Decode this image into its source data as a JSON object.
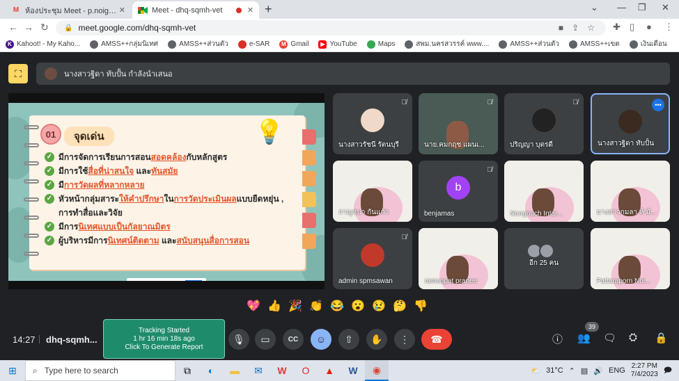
{
  "browser": {
    "tabs": [
      {
        "title": "ห้องประชุม Meet - p.noigor@gmail",
        "icon": "gmail-icon"
      },
      {
        "title": "Meet - dhq-sqmh-vet",
        "icon": "meet-icon"
      }
    ],
    "url": "meet.google.com/dhq-sqmh-vet",
    "bookmarks": [
      {
        "label": "Kahoot! - My Kaho...",
        "color": "#46178f"
      },
      {
        "label": "AMSS++กลุ่มนิเทศ",
        "color": "#3c4043"
      },
      {
        "label": "AMSS++ส่วนตัว",
        "color": "#3c4043"
      },
      {
        "label": "e-SAR",
        "color": "#d93025"
      },
      {
        "label": "Gmail",
        "color": "#ea4335"
      },
      {
        "label": "YouTube",
        "color": "#ff0000"
      },
      {
        "label": "Maps",
        "color": "#34a853"
      },
      {
        "label": "สพม.นครสวรรค์ www....",
        "color": "#3c4043"
      },
      {
        "label": "AMSS++ส่วนตัว",
        "color": "#3c4043"
      },
      {
        "label": "AMSS++เขต",
        "color": "#3c4043"
      },
      {
        "label": "เงินเดือน",
        "color": "#3c4043"
      }
    ]
  },
  "meet": {
    "presenter_text": "นางสาวฐิดา ทับปั้น กำลังนำเสนอ",
    "slide": {
      "number": "01",
      "title": "จุดเด่น",
      "bullets": [
        [
          {
            "t": "มีการจัดการเรียนการสอน",
            "h": false
          },
          {
            "t": "สอดคล้อง",
            "h": true
          },
          {
            "t": "กับหลักสูตร",
            "h": false
          }
        ],
        [
          {
            "t": "มีการใช้",
            "h": false
          },
          {
            "t": "สื่อที่น่าสนใจ",
            "h": true
          },
          {
            "t": " และ",
            "h": false
          },
          {
            "t": "ทันสมัย",
            "h": true
          }
        ],
        [
          {
            "t": "มี",
            "h": false
          },
          {
            "t": "การวัดผลที่หลากหลาย",
            "h": true
          }
        ],
        [
          {
            "t": "หัวหน้ากลุ่มสาระ",
            "h": false
          },
          {
            "t": "ให้คำปรึกษา",
            "h": true
          },
          {
            "t": "ใน",
            "h": false
          },
          {
            "t": "การวัดประเมินผล",
            "h": true
          },
          {
            "t": "แบบยืดหยุ่น , การทำสื่อและวิจัย",
            "h": false
          }
        ],
        [
          {
            "t": "มีการ",
            "h": false
          },
          {
            "t": "นิเทศแบบเป็นกัลยาณมิตร",
            "h": true
          }
        ],
        [
          {
            "t": "ผู้บริหารมีการ",
            "h": false
          },
          {
            "t": "นิเทศน์ติดตาม",
            "h": true
          },
          {
            "t": " และ",
            "h": false
          },
          {
            "t": "สนับสนุนสื่อการสอน",
            "h": true
          }
        ]
      ]
    },
    "participants": [
      {
        "name": "นางสาวรัชนี รัตนบุรี",
        "kind": "avatar",
        "muted": true
      },
      {
        "name": "นาย.คมกฤช แผนเ...",
        "kind": "camera",
        "muted": true
      },
      {
        "name": "ปริญญา บุตรดี",
        "kind": "avatar",
        "muted": true
      },
      {
        "name": "นางสาวฐิดา ทับปั้น",
        "kind": "avatar",
        "muted": false,
        "active": true
      },
      {
        "name": "กาญจนา กันแก้ว",
        "kind": "screen",
        "muted": true
      },
      {
        "name": "benjamas",
        "kind": "letter",
        "letter": "b",
        "muted": true
      },
      {
        "name": "Nongnuch Intar...",
        "kind": "screen",
        "muted": true
      },
      {
        "name": "นางสาวกมลา ห์ มั...",
        "kind": "screen",
        "muted": true
      },
      {
        "name": "admin spmsawan",
        "kind": "avatar",
        "muted": true
      },
      {
        "name": "ramonpat pranee",
        "kind": "screen",
        "muted": true
      },
      {
        "name": "อีก 25 คน",
        "kind": "others",
        "muted": false
      },
      {
        "name": "Pattaraporn Noi...",
        "kind": "screen",
        "muted": false
      }
    ],
    "reactions": [
      "💖",
      "👍",
      "🎉",
      "👏",
      "😂",
      "😮",
      "😢",
      "🤔",
      "👎"
    ],
    "time": "14:27",
    "meeting_code": "dhq-sqmh...",
    "tracking": {
      "line1": "Tracking Started",
      "line2": "1 hr 16 min 18s ago",
      "line3": "Click To Generate Report"
    },
    "participant_count": "39"
  },
  "taskbar": {
    "search_placeholder": "Type here to search",
    "weather": "31°C",
    "language": "ENG",
    "time": "2:27 PM",
    "date": "7/4/2023"
  }
}
